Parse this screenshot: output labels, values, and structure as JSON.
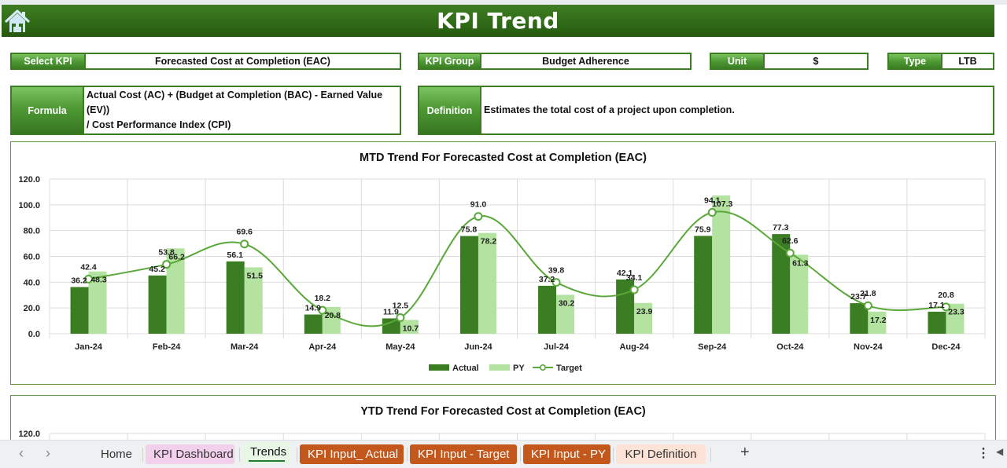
{
  "header": {
    "title": "KPI Trend",
    "home_icon": "home-icon"
  },
  "fields": {
    "select_kpi": {
      "label": "Select KPI",
      "value": "Forecasted Cost at Completion (EAC)"
    },
    "kpi_group": {
      "label": "KPI Group",
      "value": "Budget Adherence"
    },
    "unit": {
      "label": "Unit",
      "value": "$"
    },
    "type": {
      "label": "Type",
      "value": "LTB"
    },
    "formula": {
      "label": "Formula",
      "line1": "Actual Cost (AC) + (Budget at Completion (BAC) - Earned Value (EV))",
      "line2": "/ Cost Performance Index (CPI)"
    },
    "definition": {
      "label": "Definition",
      "value": "Estimates the total cost of a project upon completion."
    }
  },
  "colors": {
    "actual": "#3a7d22",
    "py": "#b3e2a1",
    "target": "#5aa83a",
    "header": "#2f6a17"
  },
  "chart_data": [
    {
      "type": "bar",
      "title": "MTD Trend For Forecasted Cost at Completion (EAC)",
      "categories": [
        "Jan-24",
        "Feb-24",
        "Mar-24",
        "Apr-24",
        "May-24",
        "Jun-24",
        "Jul-24",
        "Aug-24",
        "Sep-24",
        "Oct-24",
        "Nov-24",
        "Dec-24"
      ],
      "series": [
        {
          "name": "Actual",
          "kind": "bar",
          "values": [
            36.2,
            45.2,
            56.1,
            14.9,
            11.9,
            75.8,
            37.2,
            42.1,
            75.9,
            77.3,
            23.7,
            17.1
          ]
        },
        {
          "name": "PY",
          "kind": "bar",
          "values": [
            48.3,
            66.2,
            51.5,
            20.8,
            10.7,
            78.2,
            30.2,
            23.9,
            107.3,
            61.3,
            17.2,
            23.3
          ]
        },
        {
          "name": "Target",
          "kind": "line",
          "values": [
            42.4,
            53.8,
            69.6,
            18.2,
            12.5,
            91.0,
            39.8,
            34.1,
            94.1,
            62.6,
            21.8,
            20.8
          ]
        }
      ],
      "ylim": [
        0,
        120
      ],
      "yticks": [
        "0.0",
        "20.0",
        "40.0",
        "60.0",
        "80.0",
        "100.0",
        "120.0"
      ],
      "grid": true,
      "legend": "bottom",
      "xlabel": "",
      "ylabel": ""
    },
    {
      "type": "bar",
      "title": "YTD Trend For Forecasted Cost at Completion (EAC)",
      "yticks_visible": [
        "120.0"
      ],
      "ylim": [
        0,
        120
      ]
    }
  ],
  "tabs": [
    {
      "label": "Home",
      "style": "plain"
    },
    {
      "label": "KPI Dashboard",
      "style": "pink"
    },
    {
      "label": "Trends",
      "style": "active"
    },
    {
      "label": "KPI Input_ Actual",
      "style": "orange"
    },
    {
      "label": "KPI Input - Target",
      "style": "orange"
    },
    {
      "label": "KPI Input - PY",
      "style": "orange"
    },
    {
      "label": "KPI Definition",
      "style": "peach"
    }
  ],
  "tabbar": {
    "prev": "‹",
    "next": "›",
    "add": "+",
    "more": "⋮",
    "scroll_left": "◀"
  }
}
